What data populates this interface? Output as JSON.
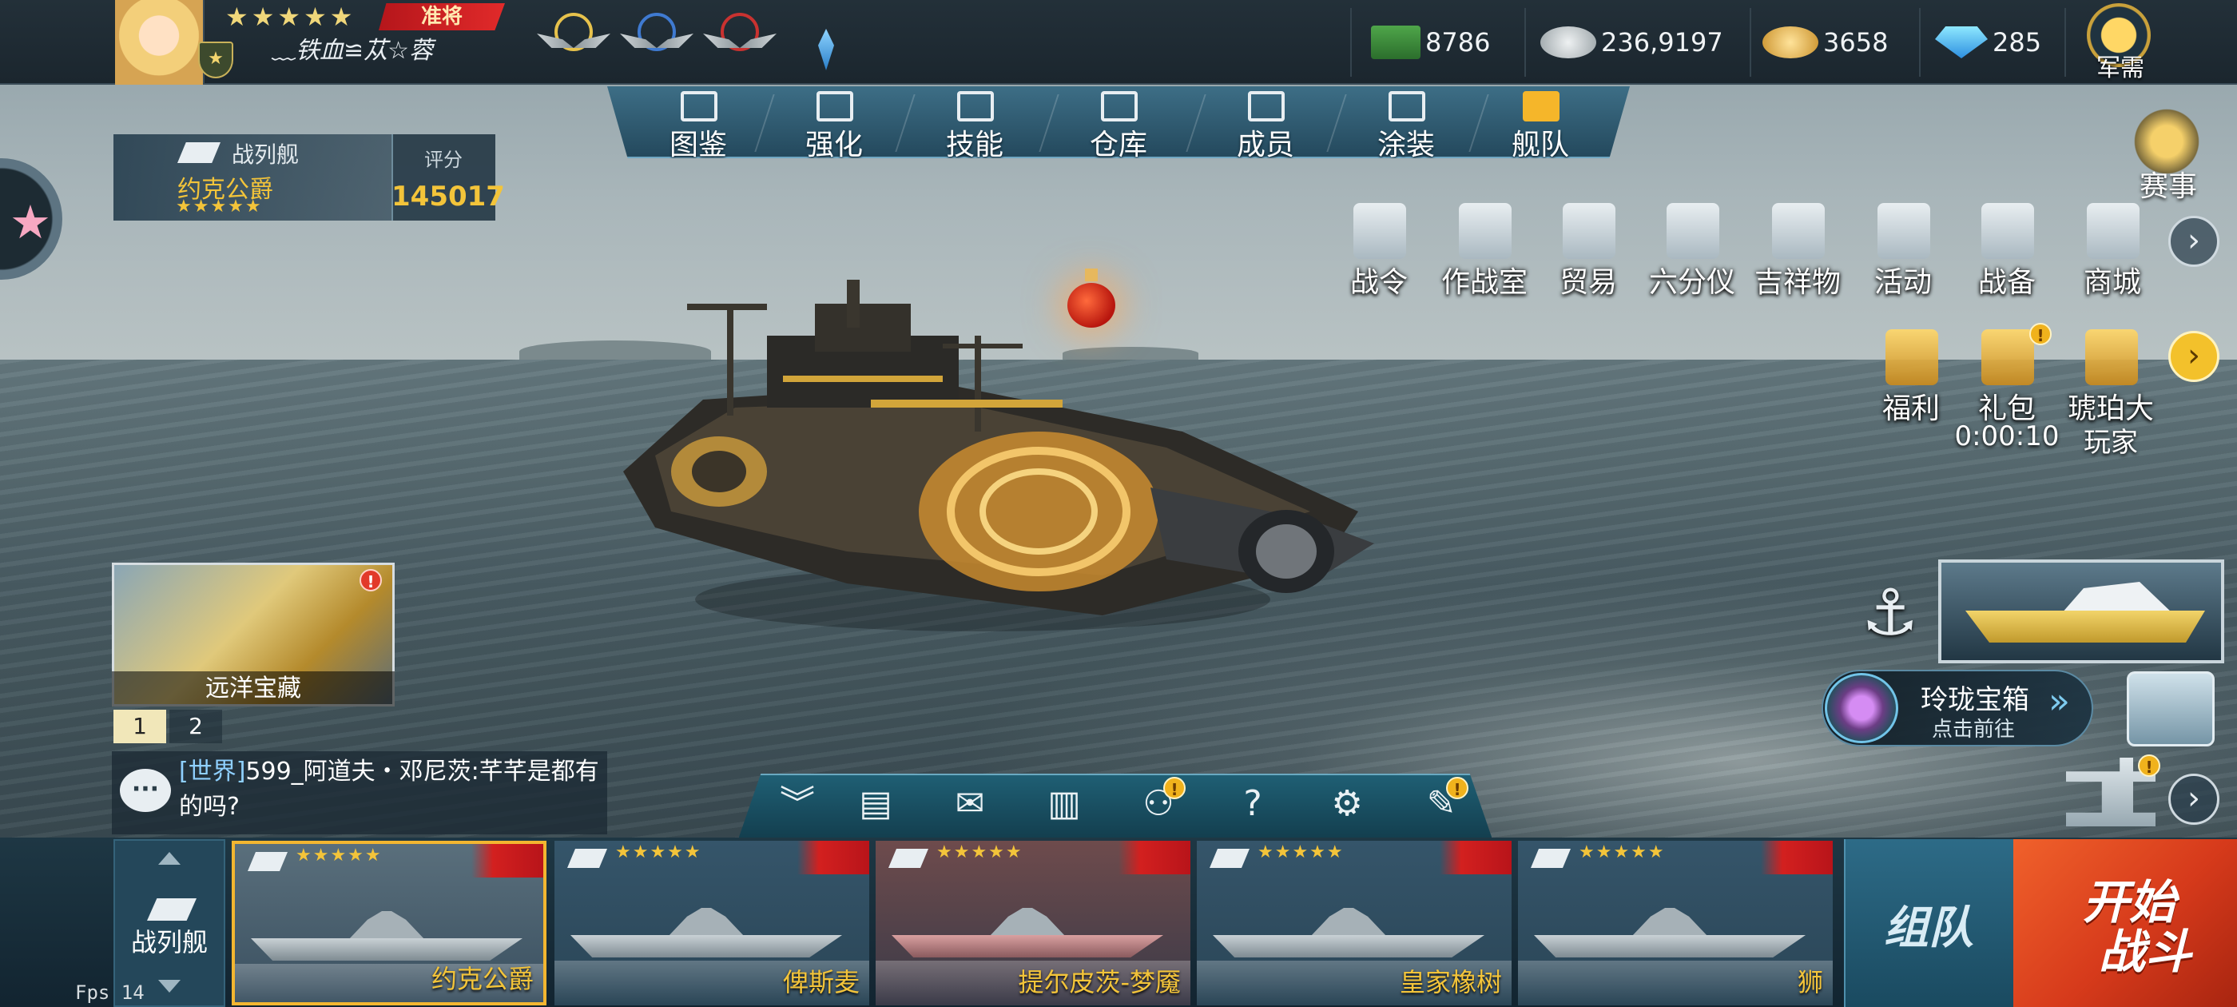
{
  "player": {
    "stars": "★★★★★",
    "rank": "准将",
    "name": "﹏铁血≌苁☆蓉"
  },
  "resources": [
    {
      "icon": "cash-icon",
      "value": "8786"
    },
    {
      "icon": "silver-coin-icon",
      "value": "236,9197"
    },
    {
      "icon": "gold-coin-icon",
      "value": "3658"
    },
    {
      "icon": "diamond-icon",
      "value": "285"
    }
  ],
  "plus": "+",
  "junxu": {
    "label": "军需"
  },
  "nav": {
    "tabs": [
      "图鉴",
      "强化",
      "技能",
      "仓库",
      "成员",
      "涂装",
      "舰队"
    ],
    "active": "舰队"
  },
  "ship_info": {
    "type": "战列舰",
    "name": "约克公爵",
    "stars": "★★★★★",
    "score_label": "评分",
    "score": "145017"
  },
  "saishi": {
    "label": "赛事"
  },
  "menu_row1": [
    "战令",
    "作战室",
    "贸易",
    "六分仪",
    "吉祥物",
    "活动",
    "战备",
    "商城"
  ],
  "menu_row2": [
    {
      "label": "福利",
      "sub": ""
    },
    {
      "label": "礼包",
      "sub": "0:00:10"
    },
    {
      "label": "琥珀大",
      "sub": "玩家"
    }
  ],
  "treasure": {
    "label": "远洋宝藏"
  },
  "page_tabs": [
    "1",
    "2"
  ],
  "chat": {
    "channel": "[世界]",
    "message": "599_阿道夫・邓尼茨:芊芊是都有的吗?"
  },
  "chest": {
    "title": "玲珑宝箱",
    "subtitle": "点击前往"
  },
  "toolbar_icons": [
    "collapse-icon",
    "clipboard-icon",
    "mail-icon",
    "ranking-icon",
    "friends-icon",
    "help-icon",
    "settings-icon",
    "hint-icon"
  ],
  "toolbar_glyphs": [
    "︾",
    "▤",
    "✉",
    "▥",
    "⚇",
    "?",
    "⚙",
    "✎"
  ],
  "fleet": {
    "type_label": "战列舰",
    "ships": [
      {
        "name": "约克公爵",
        "stars": "★★★★★",
        "selected": true
      },
      {
        "name": "俾斯麦",
        "stars": "★★★★★",
        "selected": false
      },
      {
        "name": "提尔皮茨-梦魇",
        "stars": "★★★★★",
        "selected": false
      },
      {
        "name": "皇家橡树",
        "stars": "★★★★★",
        "selected": false
      },
      {
        "name": "狮",
        "stars": "★★★★★",
        "selected": false
      }
    ]
  },
  "team_button": "组队",
  "start_button": "开始战斗",
  "fps": "Fps 14",
  "colors": {
    "accent": "#f3c43a",
    "start": "#e0421f",
    "nav": "#2d5a70"
  }
}
